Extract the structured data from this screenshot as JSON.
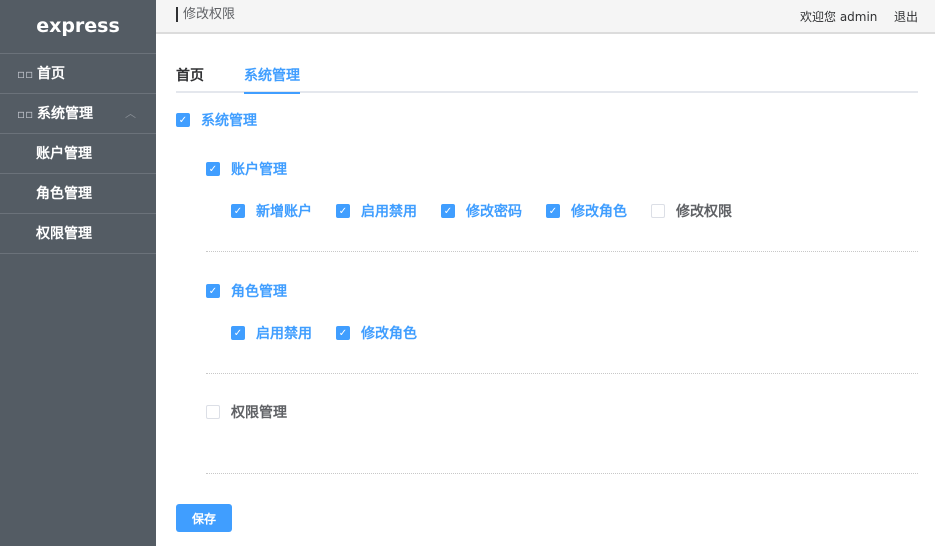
{
  "sidebar": {
    "logo": "express",
    "items": [
      {
        "label": "首页",
        "icon": "grid-icon"
      },
      {
        "label": "系统管理",
        "icon": "grid-icon",
        "expanded": true,
        "children": [
          {
            "label": "账户管理"
          },
          {
            "label": "角色管理"
          },
          {
            "label": "权限管理"
          }
        ]
      }
    ]
  },
  "header": {
    "title": "修改权限",
    "welcome": "欢迎您 admin",
    "logout": "退出"
  },
  "tabs": [
    {
      "label": "首页",
      "active": false
    },
    {
      "label": "系统管理",
      "active": true
    }
  ],
  "tree": {
    "label": "系统管理",
    "checked": true,
    "groups": [
      {
        "label": "账户管理",
        "checked": true,
        "items": [
          {
            "label": "新增账户",
            "checked": true
          },
          {
            "label": "启用禁用",
            "checked": true
          },
          {
            "label": "修改密码",
            "checked": true
          },
          {
            "label": "修改角色",
            "checked": true
          },
          {
            "label": "修改权限",
            "checked": false
          }
        ]
      },
      {
        "label": "角色管理",
        "checked": true,
        "items": [
          {
            "label": "启用禁用",
            "checked": true
          },
          {
            "label": "修改角色",
            "checked": true
          }
        ]
      },
      {
        "label": "权限管理",
        "checked": false,
        "items": []
      }
    ]
  },
  "save_label": "保存",
  "colors": {
    "accent": "#409eff",
    "sidebar": "#545c64"
  }
}
